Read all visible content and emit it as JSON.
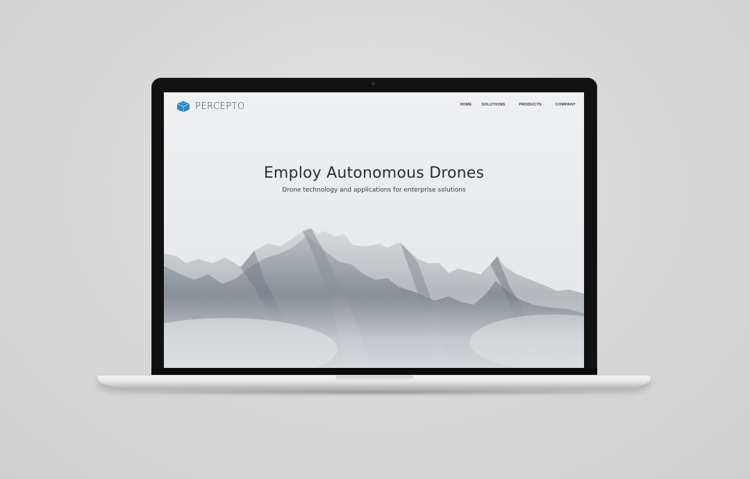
{
  "site": {
    "brand": "PERCEPTO",
    "nav": [
      {
        "label": "HOME"
      },
      {
        "label": "SOLUTIONS"
      },
      {
        "label": "PRODUCTS"
      },
      {
        "label": "COMPANY"
      }
    ]
  },
  "hero": {
    "title": "Employ Autonomous Drones",
    "subtitle": "Drone technology and applications for enterprise solutions"
  },
  "colors": {
    "brand_blue": "#2a86c8",
    "text_dark": "#2a2e33",
    "sky": "#eceef1"
  },
  "icons": {
    "logo": "hexagon-cube-icon"
  }
}
